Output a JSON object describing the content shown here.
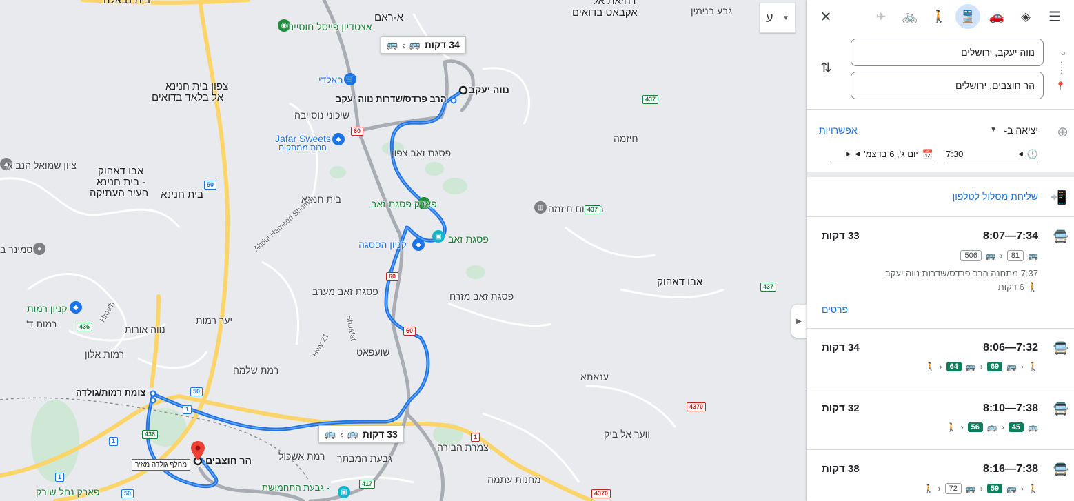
{
  "map": {
    "lang_button": "ע",
    "bubbles": [
      {
        "duration": "34 דקות"
      },
      {
        "duration": "33 דקות"
      }
    ],
    "tooltip": "מחלף גולדה מאיר",
    "labels": {
      "beit_nabala": "בית נבאלה",
      "a_ram": "א-ראם",
      "dahiyat": "דחיאת אל",
      "aqbat": "אקבאט בדואים",
      "geva_binyamin": "גבע בנימין",
      "atzteadion": "אצטדיון פייסל חוסייני",
      "baldi": "באלדי",
      "tzafon_beit_hanina": "צפון בית חנינא",
      "al_balad": "אל בלאד בדואים",
      "neve_yaakov": "נווה יעקב",
      "harav_pardes": "הרב פרדס/שדרות נווה יעקב",
      "shikuney": "שיכוני נוסייבה",
      "jafar": "Jafar Sweets",
      "hanut": "חנות ממתקים",
      "pisgat_zeev_tzafon": "פסגת זאב צפון",
      "hizma": "חיזמה",
      "tziyun": "ציון שמואל הנביא",
      "abu_dahuk": "אבו דאהוק",
      "beit_hanina_old": "- בית חנינא",
      "old_city": "העיר העתיקה",
      "beit_hanina2": "בית חנינא",
      "beit_hanina3": "בית חנינא",
      "abdul": "Abdul Hameed Shoman",
      "park_pisgat": "פארק פסגת זאב",
      "mahsom": "מחסום חיזמה",
      "pisgat_zeev": "פסגת זאב",
      "kanyon_pisga": "קניון הפסגה",
      "seminar": "סמינר ב",
      "abu_dahuk2": "אבו דאהוק",
      "kanyon_ramot": "קניון רמות",
      "ramot_d": "רמות ד'",
      "pz_maarav": "פסגת זאב מערב",
      "pz_mizrah": "פסגת זאב מזרח",
      "yaar_ramot": "יער רמות",
      "neve_orot": "נווה אורות",
      "shuafat": "Shuafat",
      "hroa": "Hroa'h",
      "ramot_alon": "רמות אלון",
      "hwy21": "Hwy 21",
      "shuafat_he": "שועפאט",
      "ramat_shlomo": "רמת שלמה",
      "anata": "ענאתא",
      "tzomet": "צומת רמות/גולדה",
      "har_hotzvim": "הר חוצבים",
      "ramat_eshkol": "רמת אשכול",
      "tzameret": "צמרת הבירה",
      "wadi": "ווער אל ביק",
      "givat_hamivtar": "גבעת המבתר",
      "mahanot": "מחנות עתמה",
      "givat_hatahmoshet": "- גבעת התחמושת",
      "park_nahal": "פארק נחל שורק"
    },
    "shields": [
      "437",
      "60",
      "50",
      "437",
      "437",
      "60",
      "60",
      "436",
      "50",
      "1",
      "1",
      "436",
      "1",
      "4370",
      "1",
      "50",
      "417",
      "4370"
    ]
  },
  "panel": {
    "close_icon": "✕",
    "origin": "נווה יעקב, ירושלים",
    "destination": "הר חוצבים, ירושלים",
    "depart_label": "יציאה ב-",
    "options_label": "אפשרויות",
    "time": "7:30",
    "date": "יום ג', 6 בדצמ'",
    "send_to_phone": "שליחת מסלול לטלפון",
    "routes": [
      {
        "time": "7:34—8:07",
        "duration": "33 דקות",
        "line1": "81",
        "line2": "506",
        "detail": "7:37 מתחנה הרב פרדס/שדרות נווה יעקב",
        "walk": "6 דקות",
        "details_link": "פרטים"
      },
      {
        "time": "7:32—8:06",
        "duration": "34 דקות",
        "line1": "69",
        "line2": "64"
      },
      {
        "time": "7:38—8:10",
        "duration": "32 דקות",
        "line1": "45",
        "line2": "56"
      },
      {
        "time": "7:38—8:16",
        "duration": "38 דקות",
        "line1": "59",
        "line2": "72"
      }
    ]
  }
}
